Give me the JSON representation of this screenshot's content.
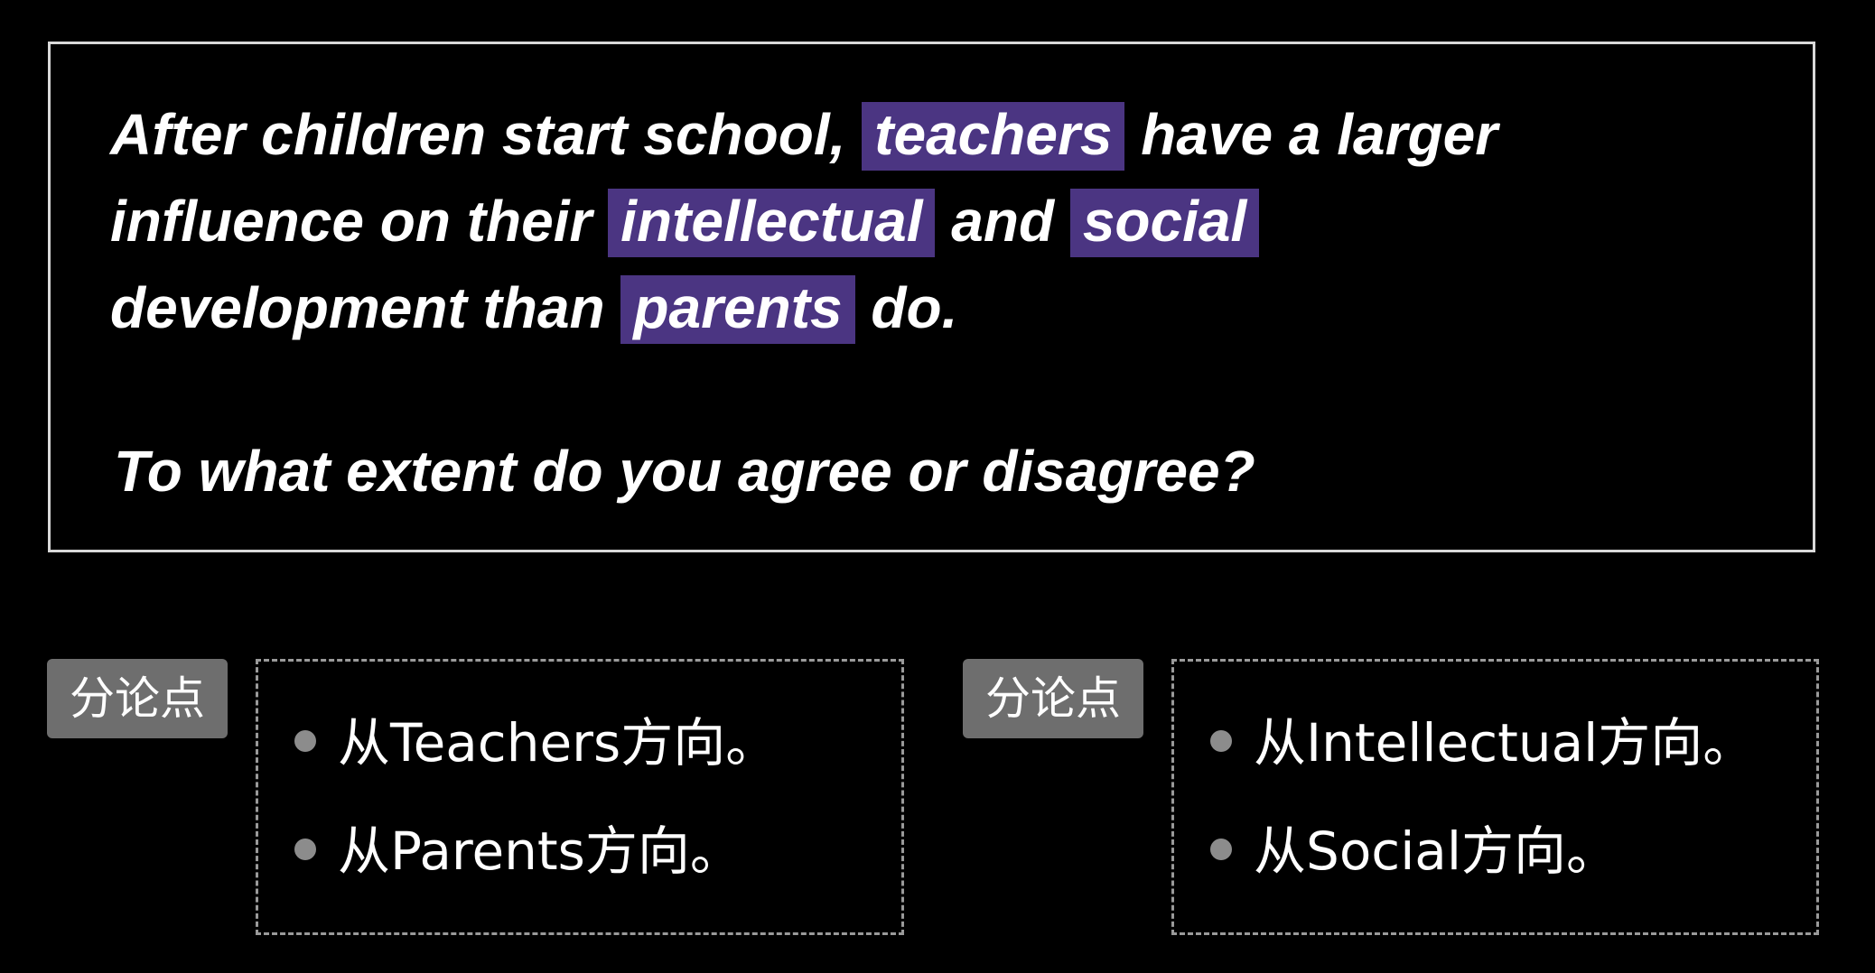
{
  "prompt": {
    "line1_a": "After children start school, ",
    "hl_teachers": "teachers",
    "line1_b": " have a larger",
    "line2_a": "influence on their ",
    "hl_intellectual": "intellectual",
    "line2_b": " and ",
    "hl_social": "social",
    "line3_a": "development than ",
    "hl_parents": "parents",
    "line3_b": " do.",
    "question": "To what extent do you agree or disagree?"
  },
  "left_group": {
    "tag": "分论点",
    "points": [
      "从Teachers方向。",
      "从Parents方向。"
    ]
  },
  "right_group": {
    "tag": "分论点",
    "points": [
      "从Intellectual方向。",
      "从Social方向。"
    ]
  },
  "colors": {
    "background": "#000000",
    "highlight": "#4b3582",
    "tag_background": "#6e6e6e",
    "border": "#d9d9d9",
    "dashed_border": "#9a9a9a"
  }
}
